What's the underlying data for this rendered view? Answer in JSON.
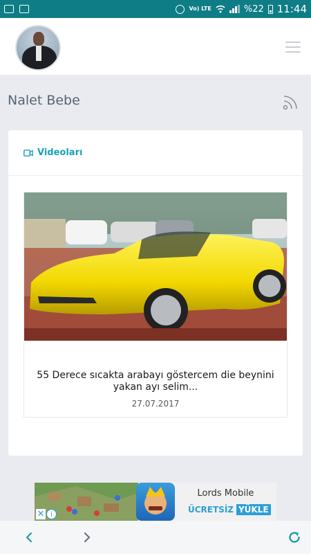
{
  "status_bar": {
    "network": "Vo) LTE",
    "battery": "%22",
    "time": "11:44"
  },
  "header": {
    "title": "Nalet Bebe"
  },
  "videos_section": {
    "label": "Videoları",
    "items": [
      {
        "title": "55 Derece sıcakta arabayı göstercem die beynini yakan ayı selim...",
        "date": "27.07.2017"
      }
    ]
  },
  "ad": {
    "app_name": "Lords Mobile",
    "free_label": "ÜCRETSİZ",
    "install_label": "YÜKLE"
  },
  "colors": {
    "status_bar": "#0f7d86",
    "accent": "#17a2b8",
    "background": "#e9ebf0",
    "nav_icons": "#1a9cb0"
  },
  "icons": {
    "header_right": "menu-icon",
    "title_right": "rss-icon",
    "section": "video-camera-icon",
    "nav": [
      "back-icon",
      "forward-icon",
      "reload-icon"
    ]
  }
}
